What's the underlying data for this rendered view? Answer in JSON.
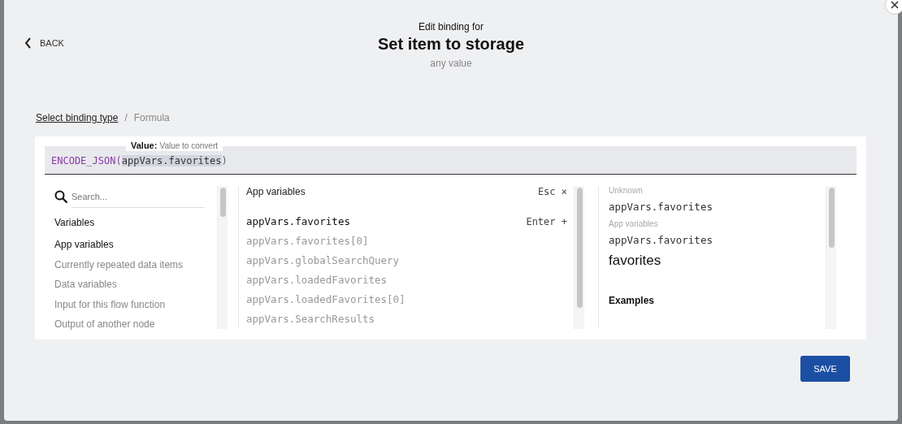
{
  "back": {
    "label": "BACK"
  },
  "header": {
    "kicker": "Edit binding for",
    "title": "Set item to storage",
    "subtitle": "any value"
  },
  "breadcrumb": {
    "link": "Select binding type",
    "separator": "/",
    "current": "Formula"
  },
  "formula": {
    "hint_label": "Value:",
    "hint_text": "Value to convert",
    "function": "ENCODE_JSON(",
    "argument": "appVars.favorites",
    "close": ")"
  },
  "search": {
    "placeholder": "Search..."
  },
  "categories_heading": "Variables",
  "categories": [
    {
      "label": "App variables",
      "selected": true
    },
    {
      "label": "Currently repeated data items",
      "selected": false
    },
    {
      "label": "Data variables",
      "selected": false
    },
    {
      "label": "Input for this flow function",
      "selected": false
    },
    {
      "label": "Output of another node",
      "selected": false
    }
  ],
  "list": {
    "heading": "App variables",
    "close_hint": "Esc",
    "close_glyph": "×",
    "add_hint": "Enter",
    "add_glyph": "+",
    "items": [
      {
        "label": "appVars.favorites",
        "selected": true
      },
      {
        "label": "appVars.favorites[0]",
        "selected": false
      },
      {
        "label": "appVars.globalSearchQuery",
        "selected": false
      },
      {
        "label": "appVars.loadedFavorites",
        "selected": false
      },
      {
        "label": "appVars.loadedFavorites[0]",
        "selected": false
      },
      {
        "label": "appVars.SearchResults",
        "selected": false
      }
    ]
  },
  "details": {
    "type_label": "Unknown",
    "type_value": "appVars.favorites",
    "group_label": "App variables",
    "group_value": "appVars.favorites",
    "name": "favorites",
    "examples_heading": "Examples"
  },
  "save_button": "SAVE"
}
